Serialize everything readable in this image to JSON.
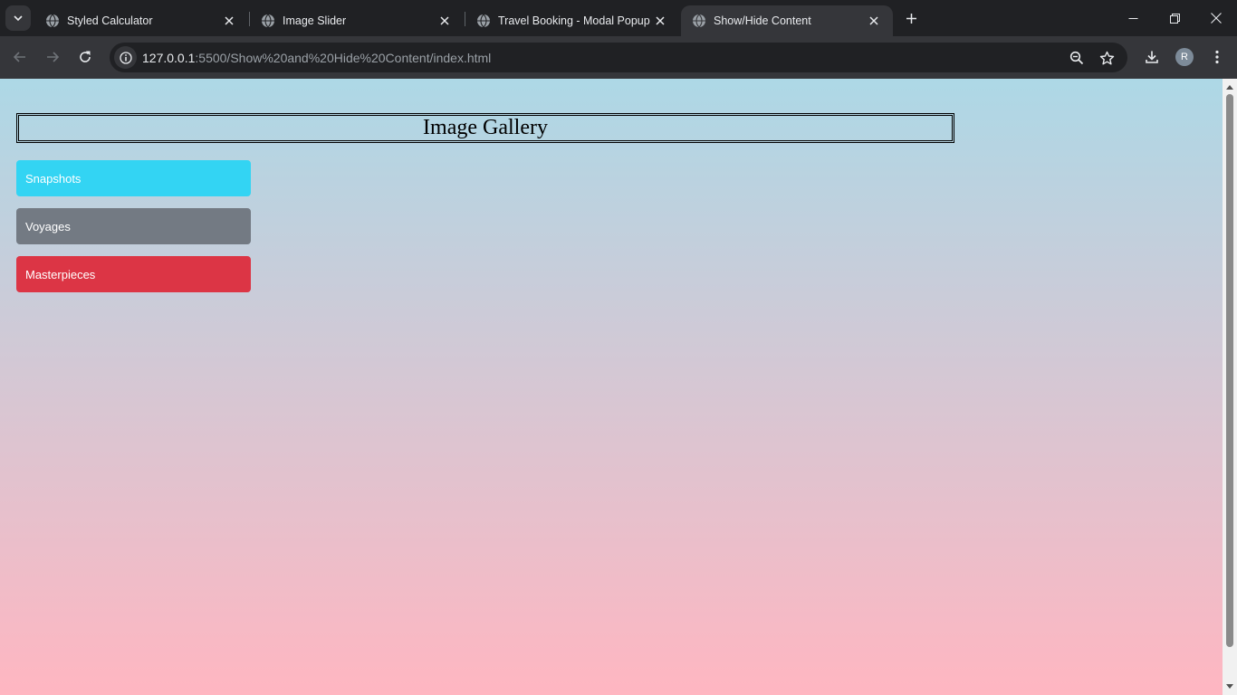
{
  "browser": {
    "tabs": [
      {
        "title": "Styled Calculator",
        "active": false
      },
      {
        "title": "Image Slider",
        "active": false
      },
      {
        "title": "Travel Booking - Modal Popup",
        "active": false
      },
      {
        "title": "Show/Hide Content",
        "active": true
      }
    ],
    "url": {
      "host": "127.0.0.1",
      "rest": ":5500/Show%20and%20Hide%20Content/index.html"
    },
    "profile_initial": "R"
  },
  "page": {
    "title": "Image Gallery",
    "buttons": [
      {
        "label": "Snapshots",
        "color": "#33d4f3"
      },
      {
        "label": "Voyages",
        "color": "#737a83"
      },
      {
        "label": "Masterpieces",
        "color": "#dc3545"
      }
    ]
  },
  "colors": {
    "gradient_top": "#add8e6",
    "gradient_bottom": "#ffb6c1",
    "chrome_dark": "#202124",
    "chrome_toolbar": "#35363a"
  }
}
